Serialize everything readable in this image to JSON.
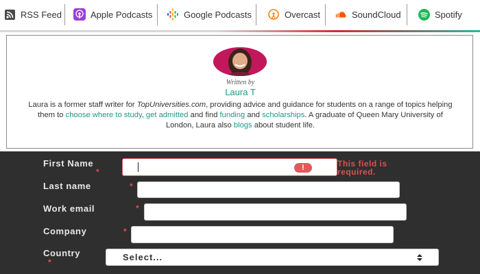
{
  "podcast_bar": {
    "items": [
      {
        "label": "RSS Feed",
        "icon": "rss-icon"
      },
      {
        "label": "Apple Podcasts",
        "icon": "apple-podcasts-icon"
      },
      {
        "label": "Google Podcasts",
        "icon": "google-podcasts-icon"
      },
      {
        "label": "Overcast",
        "icon": "overcast-icon"
      },
      {
        "label": "SoundCloud",
        "icon": "soundcloud-icon"
      },
      {
        "label": "Spotify",
        "icon": "spotify-icon"
      }
    ]
  },
  "author_card": {
    "written_by": "Written by",
    "author_name": "Laura T",
    "bio": {
      "t1": "Laura is a former staff writer for ",
      "publication": "TopUniversities.com",
      "t2": ", providing advice and guidance for students on a range of topics helping them to ",
      "link_study": "choose where to study",
      "t3": ", ",
      "link_admitted": "get admitted",
      "t4": " and find ",
      "link_funding": "funding",
      "t5": " and ",
      "link_scholarships": "scholarships",
      "t6": ". A graduate of Queen Mary University of London, Laura also ",
      "link_blogs": "blogs",
      "t7": " about student life."
    }
  },
  "form": {
    "first_name": {
      "label": "First Name",
      "value": "",
      "error": "This field is required."
    },
    "last_name": {
      "label": "Last name",
      "value": ""
    },
    "work_email": {
      "label": "Work email",
      "value": ""
    },
    "company": {
      "label": "Company",
      "value": ""
    },
    "country": {
      "label": "Country",
      "selected": "Select..."
    },
    "required_marker": "*"
  },
  "colors": {
    "accent_teal": "#1a9a87",
    "error_red": "#d9534f",
    "form_background": "#2f2f2f"
  }
}
